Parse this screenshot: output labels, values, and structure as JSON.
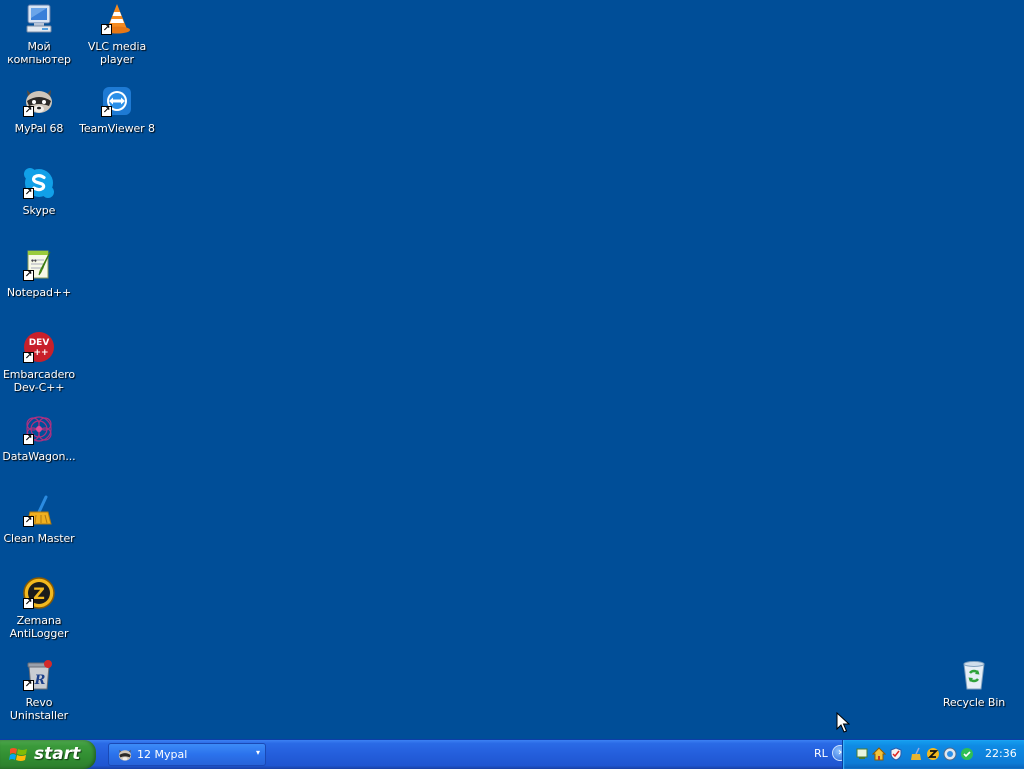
{
  "desktop": {
    "background_color": "#004e98",
    "icons": [
      {
        "id": "my-computer",
        "label": "Мой\nкомпьютер",
        "icon": "my-computer-icon",
        "shortcut": false
      },
      {
        "id": "vlc",
        "label": "VLC media\nplayer",
        "icon": "vlc-cone-icon",
        "shortcut": true
      },
      {
        "id": "mypal",
        "label": "MyPal 68",
        "icon": "mypal-raccoon-icon",
        "shortcut": true
      },
      {
        "id": "teamviewer",
        "label": "TeamViewer 8",
        "icon": "teamviewer-icon",
        "shortcut": true
      },
      {
        "id": "skype",
        "label": "Skype",
        "icon": "skype-icon",
        "shortcut": true
      },
      {
        "id": "notepadpp",
        "label": "Notepad++",
        "icon": "notepad-plus-plus-icon",
        "shortcut": true
      },
      {
        "id": "devcpp",
        "label": "Embarcadero\nDev-C++",
        "icon": "devcpp-icon",
        "shortcut": true
      },
      {
        "id": "datawagon",
        "label": "DataWagon...",
        "icon": "datawagon-icon",
        "shortcut": true
      },
      {
        "id": "cleanmaster",
        "label": "Clean Master",
        "icon": "broom-icon",
        "shortcut": true
      },
      {
        "id": "zemana",
        "label": "Zemana\nAntiLogger",
        "icon": "zemana-icon",
        "shortcut": true
      },
      {
        "id": "revo",
        "label": "Revo\nUninstaller",
        "icon": "revo-uninstaller-icon",
        "shortcut": true
      },
      {
        "id": "recyclebin",
        "label": "Recycle Bin",
        "icon": "recycle-bin-icon",
        "shortcut": false
      }
    ]
  },
  "taskbar": {
    "start_label": "start",
    "task": {
      "label": "12 Mypal",
      "icon": "mypal-raccoon-icon",
      "dropdown": "▾"
    },
    "language": "RL",
    "tray_expand": "›",
    "tray_icons": [
      "network-icon",
      "home-icon",
      "shield-icon",
      "cleaner-icon",
      "zemana-tray-icon",
      "teamviewer-tray-icon",
      "skype-tray-icon"
    ],
    "clock": "22:36"
  },
  "colors": {
    "taskbar_blue": "#245edb",
    "start_green": "#3b9a3b",
    "tray_blue": "#0f8be4",
    "label_text": "#ffffff"
  },
  "labels": {
    "dev_badge": "DEV",
    "dev_badge_plus": "++",
    "devcpp_dev": "DEV",
    "devcpp_plus": "++",
    "zemana_letter": "Z",
    "revo_letter": "R",
    "np_arrow": "↔",
    "shortcut_arrow": "↗"
  }
}
